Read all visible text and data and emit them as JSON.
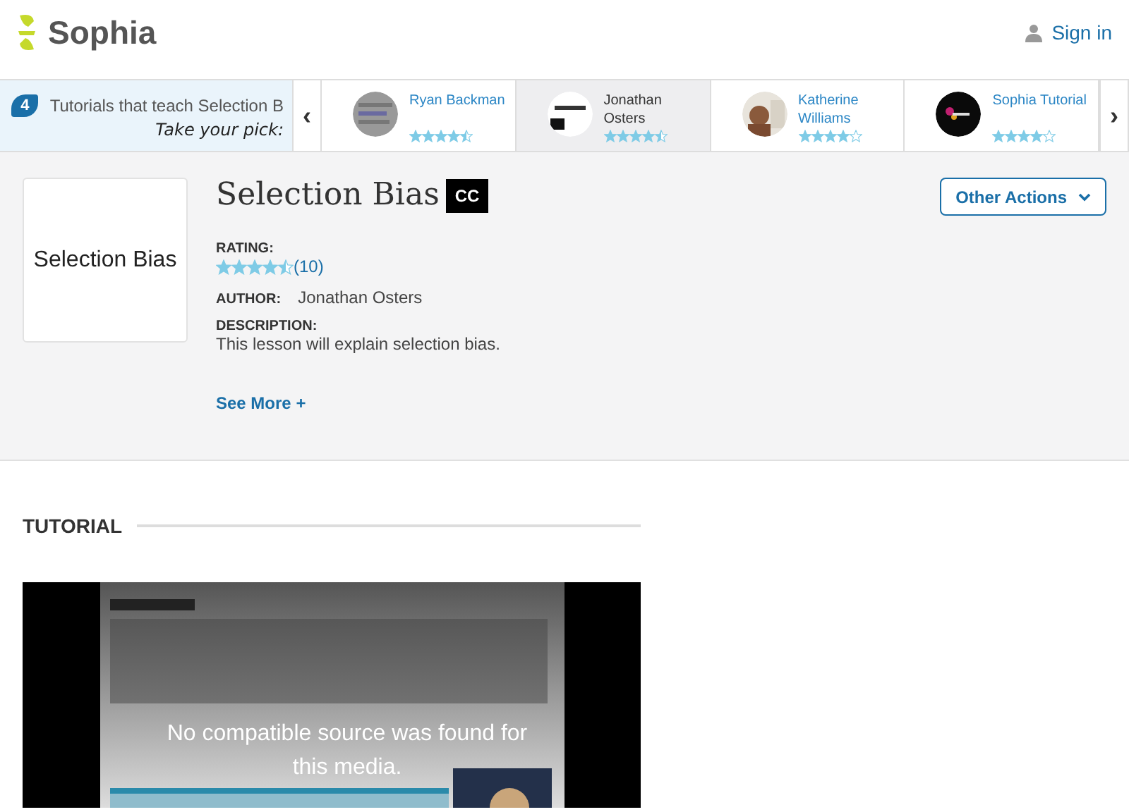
{
  "header": {
    "logo": "Sophia",
    "sign_in": "Sign in"
  },
  "carousel": {
    "count": "4",
    "intro": "Tutorials that teach Selection B",
    "tagline": "Take your pick:",
    "prev": "‹",
    "next": "›",
    "items": [
      {
        "name": "Ryan Backman",
        "stars": 4.5,
        "selected": false
      },
      {
        "name": "Jonathan Osters",
        "stars": 4.5,
        "selected": true
      },
      {
        "name": "Katherine Williams",
        "stars": 4,
        "selected": false
      },
      {
        "name": "Sophia Tutorial",
        "stars": 4,
        "selected": false
      }
    ]
  },
  "lesson": {
    "thumbnail_text": "Selection Bias",
    "title": "Selection Bias",
    "cc": "CC",
    "rating_label": "RATING:",
    "stars": 4.5,
    "rating_count": "(10)",
    "author_label": "AUTHOR:",
    "author": "Jonathan Osters",
    "description_label": "DESCRIPTION:",
    "description": "This lesson will explain selection bias.",
    "see_more": "See More +",
    "other_actions": "Other Actions"
  },
  "tutorial": {
    "heading": "TUTORIAL",
    "player_message": "No compatible source was found for this media."
  }
}
